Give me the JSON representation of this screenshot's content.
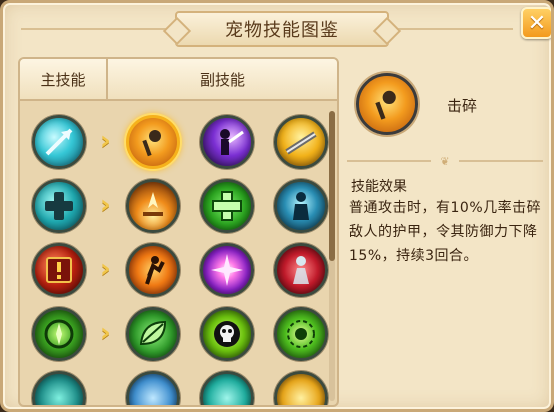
{
  "window": {
    "title": "宠物技能图鉴",
    "close_glyph": "✕"
  },
  "tabs": {
    "main": "主技能",
    "sub": "副技能"
  },
  "rows": [
    {
      "main": "spear-thrust-icon",
      "subs": [
        "smash-icon",
        "shadow-strike-icon",
        "golden-slash-icon"
      ]
    },
    {
      "main": "heal-cross-icon",
      "subs": [
        "burst-flame-icon",
        "green-cross-icon",
        "aura-figure-icon"
      ]
    },
    {
      "main": "warning-book-icon",
      "subs": [
        "fire-dancer-icon",
        "purple-burst-icon",
        "crimson-spirit-icon"
      ]
    },
    {
      "main": "compass-ring-icon",
      "subs": [
        "leaf-icon",
        "skull-icon",
        "green-vortex-icon"
      ]
    },
    {
      "main": "teal-ring-icon",
      "subs": [
        "blue-orb-icon",
        "teal-orb-icon",
        "sun-orb-icon"
      ]
    }
  ],
  "detail": {
    "icon": "smash-icon",
    "name": "击碎",
    "effect_title": "技能效果",
    "effect_desc": "普通攻击时，有10%几率击碎敌人的护甲，令其防御力下降15%，持续3回合。"
  },
  "colors": {
    "accent": "#f39a1d",
    "panel": "#f3e5c6",
    "border": "#c9a877"
  }
}
